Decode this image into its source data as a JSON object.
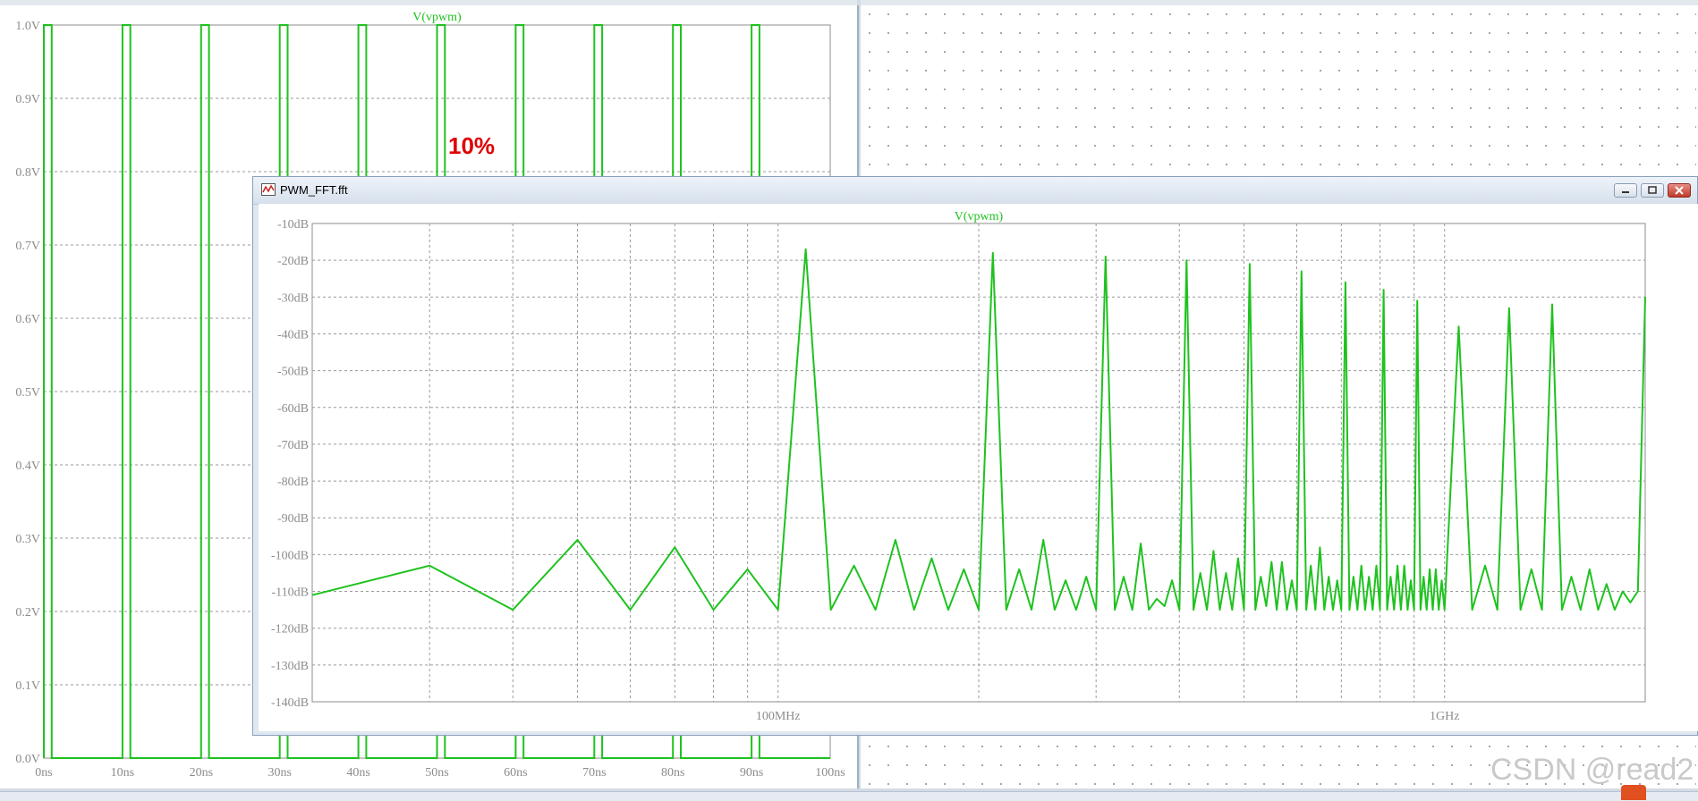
{
  "left_plot": {
    "trace_title": "V(vpwm)",
    "y_ticks": [
      "1.0V",
      "0.9V",
      "0.8V",
      "0.7V",
      "0.6V",
      "0.5V",
      "0.4V",
      "0.3V",
      "0.2V",
      "0.1V",
      "0.0V"
    ],
    "x_ticks": [
      "0ns",
      "10ns",
      "20ns",
      "30ns",
      "40ns",
      "50ns",
      "60ns",
      "70ns",
      "80ns",
      "90ns",
      "100ns"
    ],
    "annotation": "10%",
    "trace_color": "#1fc21f"
  },
  "fft_window": {
    "title": "PWM_FFT.fft",
    "icon": "waveform-icon",
    "buttons": {
      "minimize": "minimize-icon",
      "maximize": "maximize-icon",
      "close": "close-icon"
    }
  },
  "fft_plot": {
    "trace_title": "V(vpwm)",
    "y_ticks": [
      "-10dB",
      "-20dB",
      "-30dB",
      "-40dB",
      "-50dB",
      "-60dB",
      "-70dB",
      "-80dB",
      "-90dB",
      "-100dB",
      "-110dB",
      "-120dB",
      "-130dB",
      "-140dB"
    ],
    "x_ticks": [
      "100MHz",
      "1GHz"
    ],
    "trace_color": "#1fc21f"
  },
  "chart_data": [
    {
      "type": "line",
      "title": "V(vpwm)",
      "xlabel": "",
      "ylabel": "",
      "xlim": [
        0,
        100
      ],
      "ylim": [
        0,
        1.0
      ],
      "grid": true,
      "description_units": {
        "x": "ns",
        "y": "V"
      },
      "series": [
        {
          "name": "V(vpwm)",
          "x": [
            0,
            0,
            1,
            1,
            10,
            10,
            11,
            11,
            20,
            20,
            21,
            21,
            30,
            30,
            31,
            31,
            40,
            40,
            41,
            41,
            50,
            50,
            51,
            51,
            60,
            60,
            61,
            61,
            70,
            70,
            71,
            71,
            80,
            80,
            81,
            81,
            90,
            90,
            91,
            91,
            100
          ],
          "values": [
            0,
            1,
            1,
            0,
            0,
            1,
            1,
            0,
            0,
            1,
            1,
            0,
            0,
            1,
            1,
            0,
            0,
            1,
            1,
            0,
            0,
            1,
            1,
            0,
            0,
            1,
            1,
            0,
            0,
            1,
            1,
            0,
            0,
            1,
            1,
            0,
            0,
            1,
            1,
            0,
            0
          ]
        }
      ]
    },
    {
      "type": "line",
      "title": "V(vpwm)",
      "xlabel": "",
      "ylabel": "",
      "x_scale": "log",
      "xlim": [
        20,
        2000
      ],
      "ylim": [
        -140,
        -10
      ],
      "grid": true,
      "description_units": {
        "x": "MHz",
        "y": "dB"
      },
      "series": [
        {
          "name": "V(vpwm)",
          "x": [
            20,
            30,
            40,
            50,
            60,
            70,
            80,
            90,
            100,
            110,
            120,
            130,
            140,
            150,
            160,
            170,
            180,
            190,
            200,
            210,
            220,
            230,
            240,
            250,
            260,
            270,
            280,
            290,
            300,
            310,
            320,
            330,
            340,
            350,
            360,
            370,
            380,
            390,
            400,
            410,
            420,
            430,
            440,
            450,
            460,
            470,
            480,
            490,
            500,
            510,
            520,
            530,
            540,
            550,
            560,
            570,
            580,
            590,
            600,
            610,
            620,
            630,
            640,
            650,
            660,
            670,
            680,
            690,
            700,
            710,
            720,
            730,
            740,
            750,
            760,
            770,
            780,
            790,
            800,
            810,
            820,
            830,
            840,
            850,
            860,
            870,
            880,
            890,
            900,
            910,
            920,
            930,
            940,
            950,
            960,
            970,
            980,
            990,
            1000,
            1050,
            1100,
            1150,
            1200,
            1250,
            1300,
            1350,
            1400,
            1450,
            1500,
            1550,
            1600,
            1650,
            1700,
            1750,
            1800,
            1850,
            1900,
            1950,
            2000
          ],
          "values": [
            -111,
            -103,
            -115,
            -96,
            -115,
            -98,
            -115,
            -104,
            -115,
            -17,
            -115,
            -103,
            -115,
            -96,
            -115,
            -101,
            -115,
            -104,
            -115,
            -18,
            -115,
            -104,
            -115,
            -96,
            -115,
            -107,
            -115,
            -106,
            -115,
            -19,
            -115,
            -106,
            -115,
            -97,
            -115,
            -112,
            -114,
            -107,
            -115,
            -20,
            -115,
            -105,
            -115,
            -99,
            -115,
            -105,
            -115,
            -101,
            -115,
            -21,
            -115,
            -106,
            -114,
            -102,
            -115,
            -102,
            -115,
            -107,
            -115,
            -23,
            -115,
            -103,
            -115,
            -98,
            -115,
            -106,
            -115,
            -107,
            -115,
            -26,
            -115,
            -106,
            -115,
            -103,
            -115,
            -106,
            -115,
            -103,
            -115,
            -28,
            -115,
            -106,
            -115,
            -103,
            -115,
            -103,
            -115,
            -107,
            -115,
            -31,
            -115,
            -106,
            -115,
            -104,
            -115,
            -104,
            -115,
            -107,
            -115,
            -38,
            -115,
            -103,
            -115,
            -33,
            -115,
            -104,
            -115,
            -32,
            -115,
            -106,
            -115,
            -104,
            -115,
            -108,
            -115,
            -110,
            -113,
            -110,
            -30
          ]
        }
      ]
    }
  ]
}
